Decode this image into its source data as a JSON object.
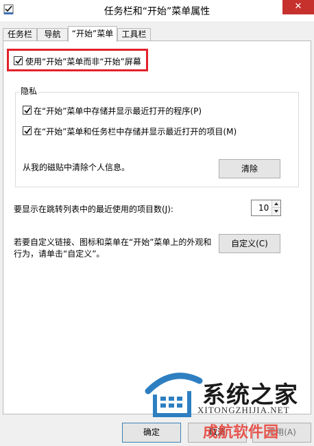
{
  "window": {
    "title": "任务栏和“开始”菜单属性",
    "close_glyph": "✕"
  },
  "tabs": [
    {
      "label": "任务栏",
      "active": false
    },
    {
      "label": "导航",
      "active": false
    },
    {
      "label": "“开始”菜单",
      "active": true
    },
    {
      "label": "工具栏",
      "active": false
    }
  ],
  "start_screen_option": {
    "label": "使用“开始”菜单而非“开始”屏幕",
    "checked": true
  },
  "privacy": {
    "title": "隐私",
    "store_programs": {
      "label": "在“开始”菜单中存储并显示最近打开的程序(P)",
      "checked": true
    },
    "store_items": {
      "label": "在“开始”菜单和任务栏中存储并显示最近打开的项目(M)",
      "checked": true
    },
    "clear_text": "从我的磁贴中清除个人信息。",
    "clear_button": "清除"
  },
  "jump_list": {
    "label": "要显示在跳转列表中的最近使用的项目数(J):",
    "value": "10"
  },
  "customize": {
    "line1": "若要自定义链接、图标和菜单在“开始”菜单上的外观和",
    "line2": "行为，请单击“自定义”。",
    "button": "自定义(C)"
  },
  "footer": {
    "ok": "确定",
    "cancel": "取消",
    "apply": "应用(A)"
  },
  "watermark": {
    "cn": "系统之家",
    "en": "XITONGZHIJIA.NET",
    "red": "成航软件园"
  },
  "colors": {
    "highlight": "#e3202a",
    "close": "#c7312d"
  },
  "icons": {
    "window": "taskbar-properties-icon",
    "check": "checkmark-icon"
  }
}
